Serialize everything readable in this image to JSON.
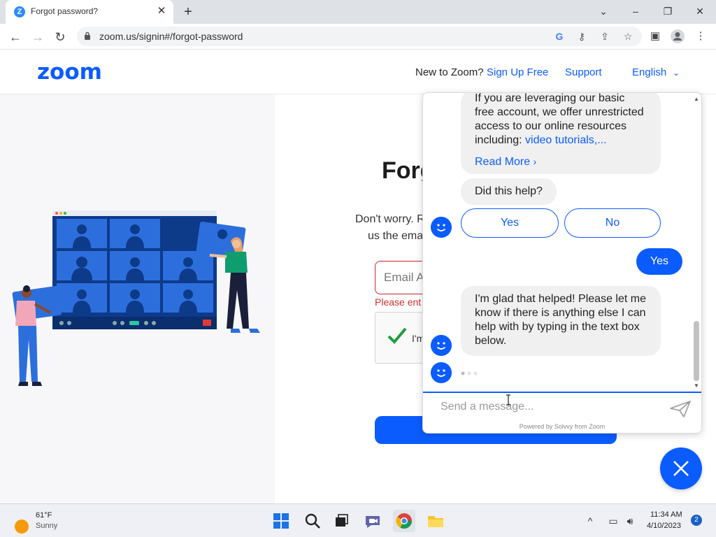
{
  "browser": {
    "tab_title": "Forgot password?",
    "url": "zoom.us/signin#/forgot-password"
  },
  "header": {
    "logo": "zoom",
    "new_to_zoom": "New to Zoom?",
    "signup": "Sign Up Free",
    "support": "Support",
    "language": "English"
  },
  "page": {
    "title_visible": "Forg",
    "subtitle_line1": "Don't worry. R",
    "subtitle_line2": "us the ema",
    "email_placeholder": "Email A",
    "error_text": "Please ent",
    "captcha_label": "I'm"
  },
  "chat": {
    "msg1_text": "If you are leveraging our basic free account, we offer unrestricted access to our online resources including: ",
    "msg1_link": "video tutorials,...",
    "read_more": "Read More",
    "question": "Did this help?",
    "yes_option": "Yes",
    "no_option": "No",
    "user_reply": "Yes",
    "reply": "I'm glad that helped! Please let me know if there is anything else I can help with by typing in the text box below.",
    "input_placeholder": "Send a message...",
    "powered_by": "Powered by Solvvy from Zoom"
  },
  "taskbar": {
    "temperature": "61°F",
    "weather": "Sunny",
    "time": "11:34 AM",
    "date": "4/10/2023",
    "notifications": "2"
  },
  "colors": {
    "brand": "#0b5cff",
    "error": "#d32f2f"
  }
}
